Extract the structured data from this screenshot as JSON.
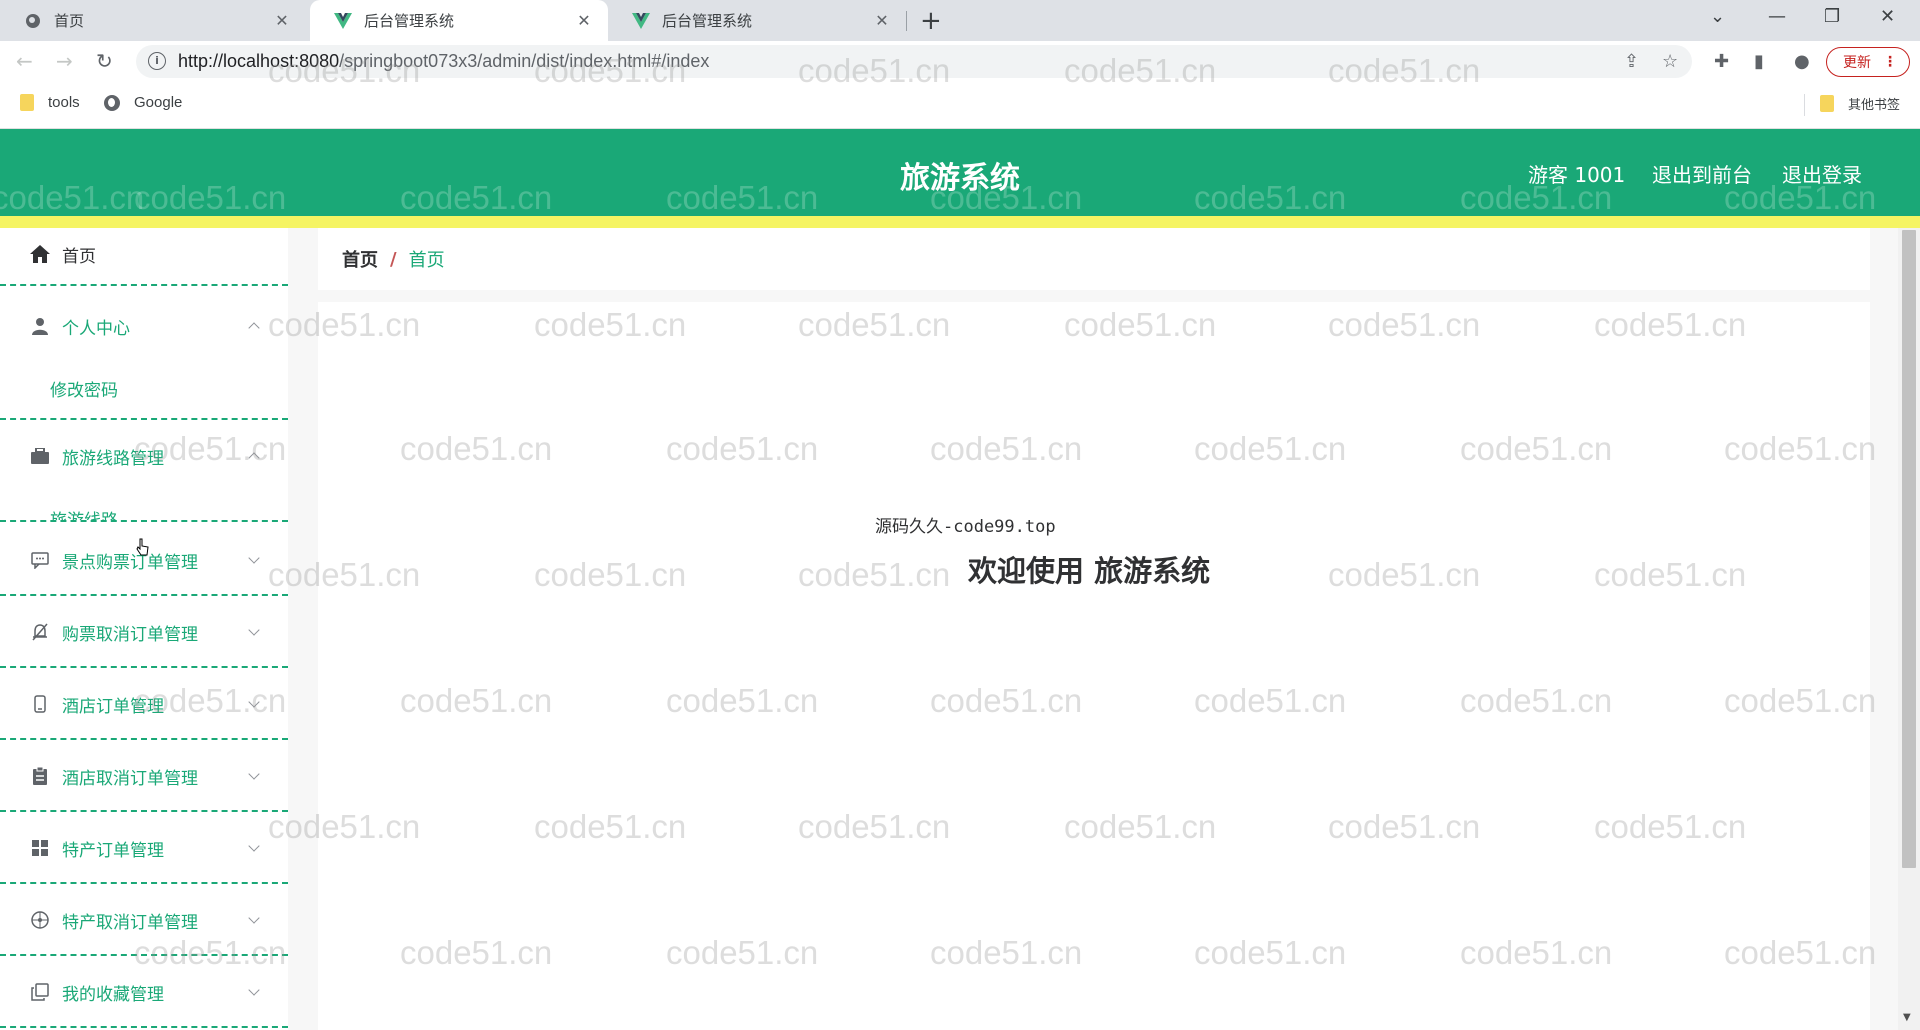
{
  "browser": {
    "tabs": [
      {
        "title": "首页",
        "active": false
      },
      {
        "title": "后台管理系统",
        "active": true
      },
      {
        "title": "后台管理系统",
        "active": false
      }
    ],
    "url_host": "http://localhost:8080",
    "url_path": "/springboot073x3/admin/dist/index.html#/index",
    "update_label": "更新",
    "bookmarks": [
      {
        "label": "tools",
        "icon": "folder-icon"
      },
      {
        "label": "Google",
        "icon": "globe-icon"
      }
    ],
    "other_bookmarks": "其他书签"
  },
  "header": {
    "title": "旅游系统",
    "user": "游客 1001",
    "front_link": "退出到前台",
    "logout_link": "退出登录",
    "accent_color": "#1aa877",
    "strip_color": "#f5f463"
  },
  "sidebar": {
    "home": "首页",
    "items": [
      {
        "label": "个人中心",
        "icon": "user-icon",
        "sub": "修改密码"
      },
      {
        "label": "旅游线路管理",
        "icon": "briefcase-icon",
        "sub": "旅游线路"
      },
      {
        "label": "景点购票订单管理",
        "icon": "chat-icon"
      },
      {
        "label": "购票取消订单管理",
        "icon": "bell-off-icon"
      },
      {
        "label": "酒店订单管理",
        "icon": "mobile-icon"
      },
      {
        "label": "酒店取消订单管理",
        "icon": "clipboard-icon"
      },
      {
        "label": "特产订单管理",
        "icon": "grid-icon"
      },
      {
        "label": "特产取消订单管理",
        "icon": "compass-icon"
      },
      {
        "label": "我的收藏管理",
        "icon": "copy-icon"
      }
    ]
  },
  "breadcrumb": {
    "home": "首页",
    "separator": "/",
    "current": "首页"
  },
  "main": {
    "source_note": "源码久久-code99.top",
    "welcome": "欢迎使用 旅游系统"
  },
  "watermark": "code51.cn"
}
